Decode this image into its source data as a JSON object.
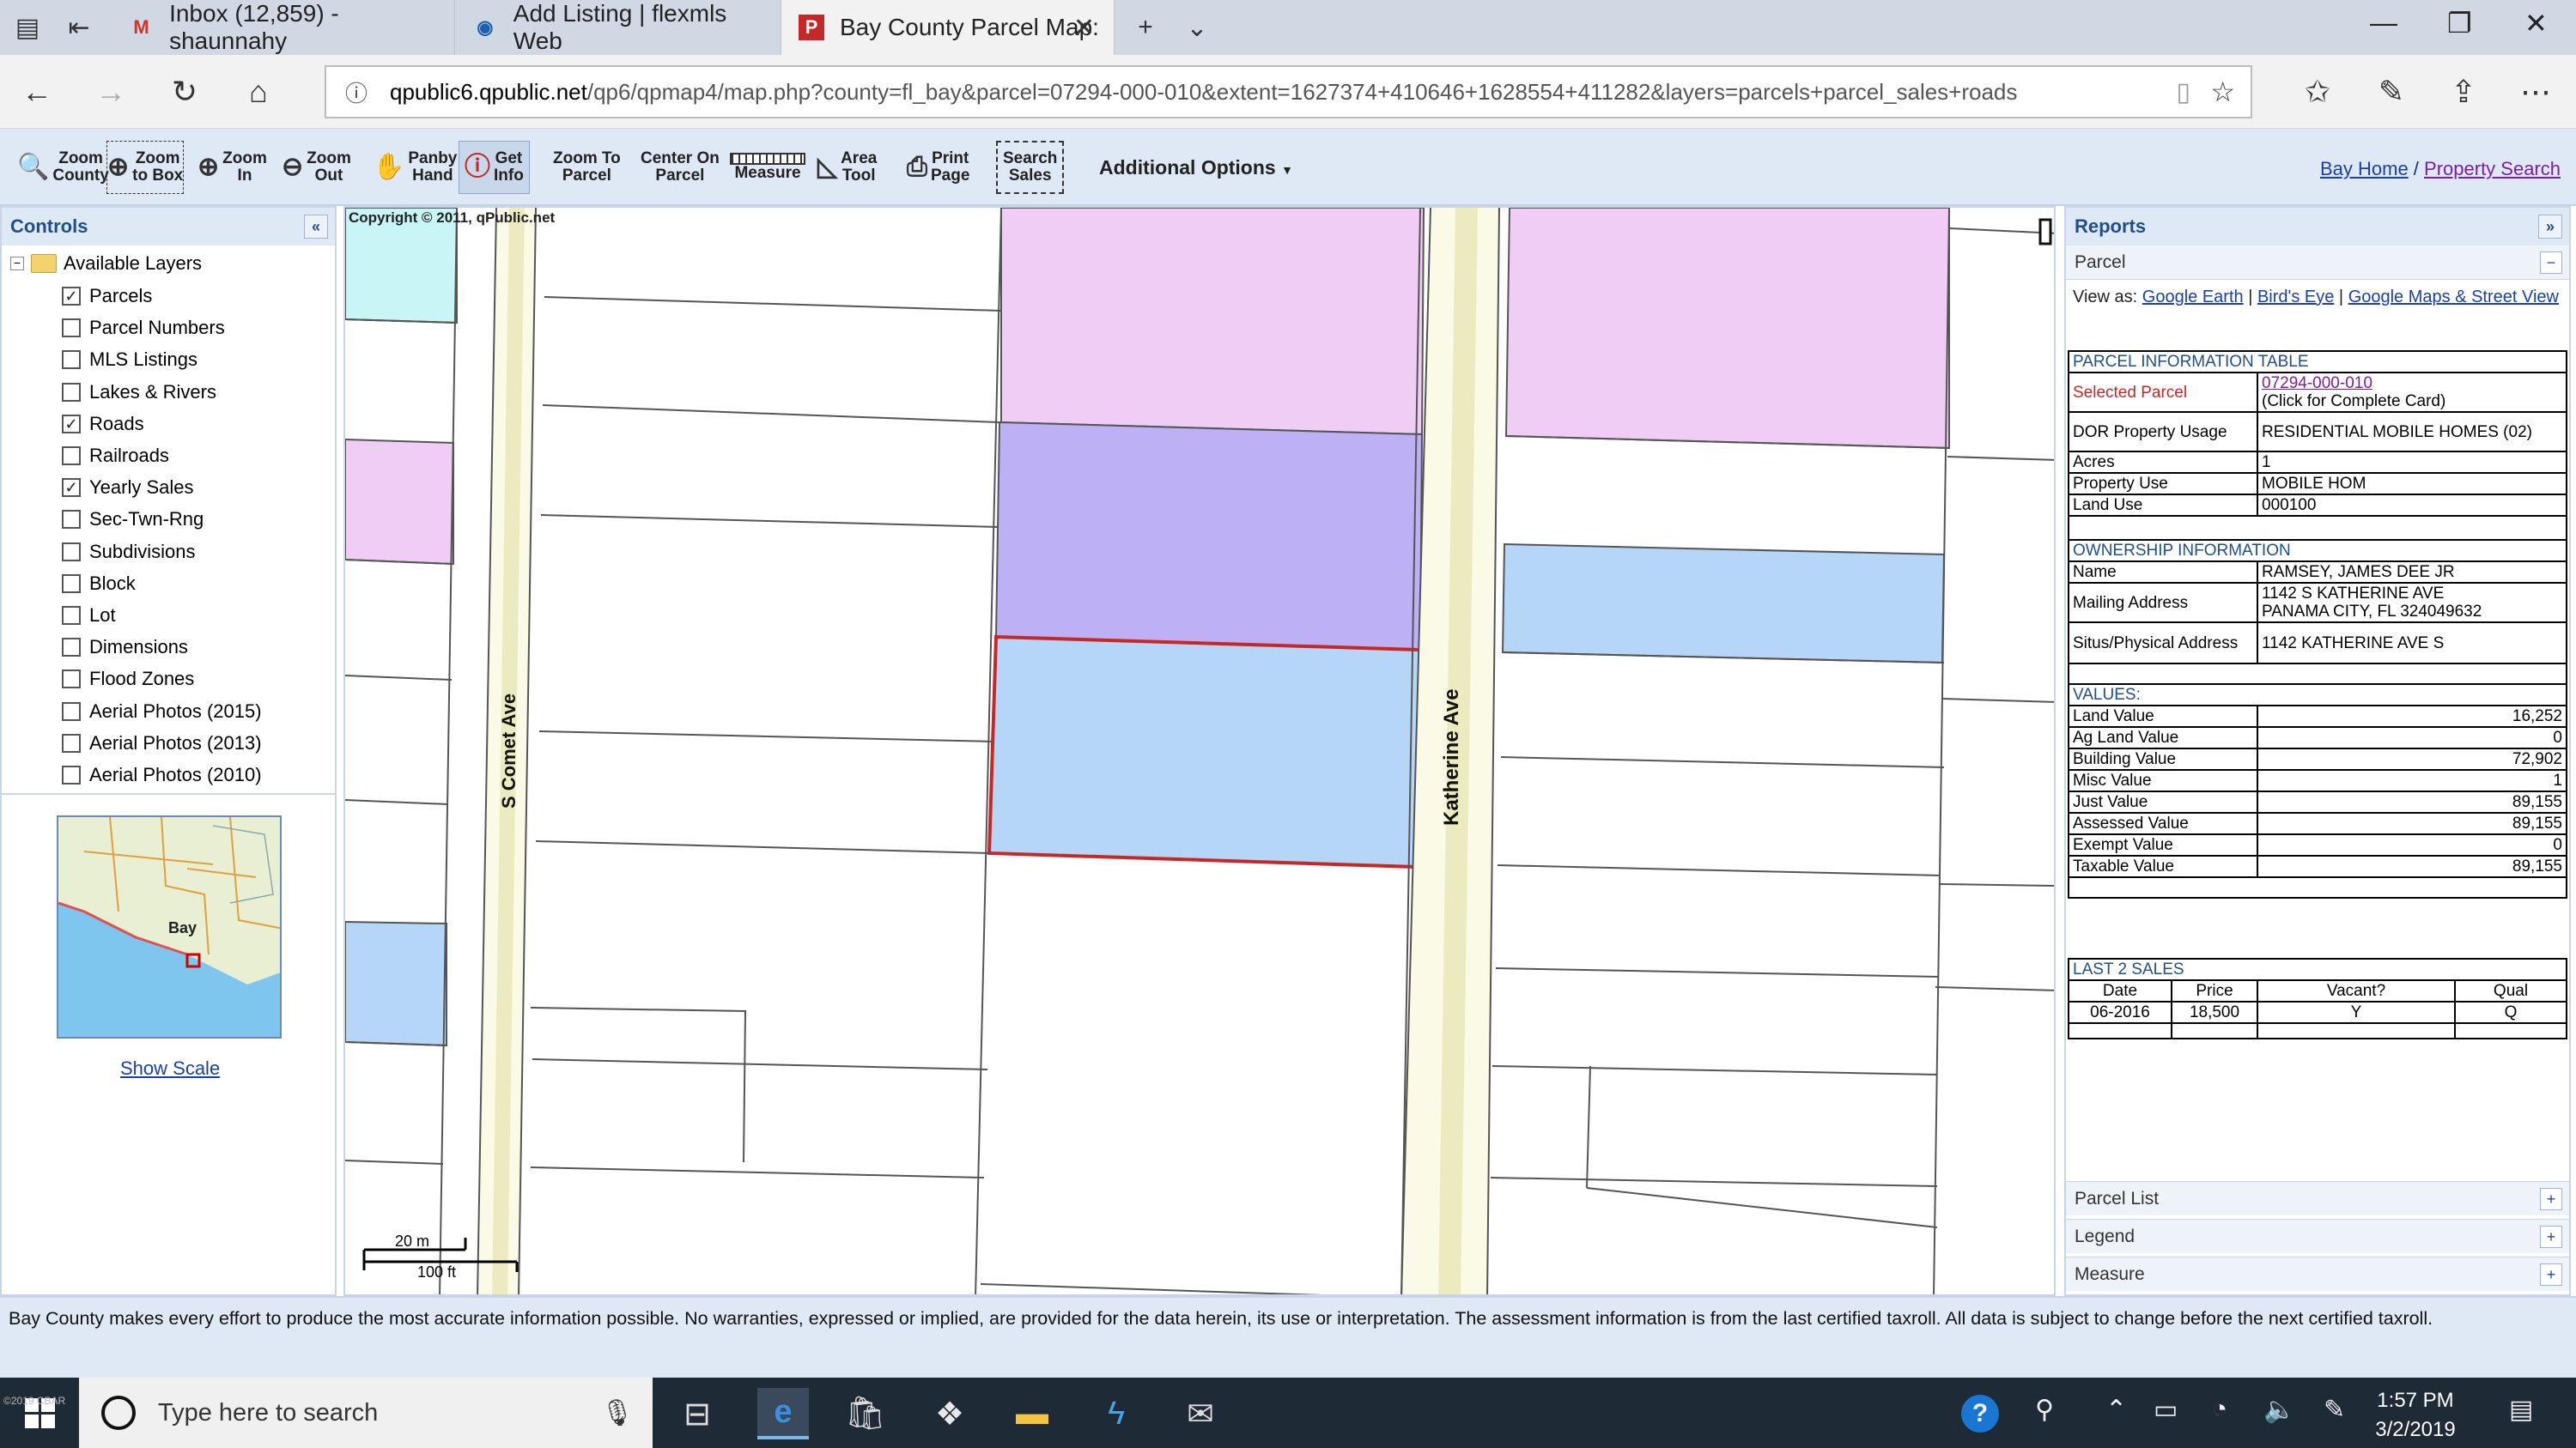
{
  "browser": {
    "tabs": [
      {
        "label": "Inbox (12,859) - shaunnahy",
        "favicon": "gmail-icon"
      },
      {
        "label": "Add Listing | flexmls Web",
        "favicon": "flexmls-icon"
      },
      {
        "label": "Bay County Parcel Map:",
        "favicon": "qpublic-icon",
        "active": true
      }
    ],
    "url_host": "qpublic6.qpublic.net",
    "url_path": "/qp6/qpmap4/map.php?county=fl_bay&parcel=07294-000-010&extent=1627374+410646+1628554+411282&layers=parcels+parcel_sales+roads"
  },
  "toolbar": {
    "tools": [
      {
        "line1": "Zoom",
        "line2": "County",
        "icon": "zoom-county-icon"
      },
      {
        "line1": "Zoom",
        "line2": "to Box",
        "icon": "zoom-box-icon"
      },
      {
        "line1": "Zoom",
        "line2": "In",
        "icon": "zoom-in-icon"
      },
      {
        "line1": "Zoom",
        "line2": "Out",
        "icon": "zoom-out-icon"
      },
      {
        "line1": "Panby",
        "line2": "Hand",
        "icon": "hand-icon"
      },
      {
        "line1": "Get",
        "line2": "Info",
        "icon": "info-icon",
        "active": true
      },
      {
        "line1": "Zoom To",
        "line2": "Parcel",
        "icon": ""
      },
      {
        "line1": "Center On",
        "line2": "Parcel",
        "icon": ""
      },
      {
        "line1": "",
        "line2": "Measure",
        "icon": "ruler-icon"
      },
      {
        "line1": "Area",
        "line2": "Tool",
        "icon": "area-icon"
      },
      {
        "line1": "Print",
        "line2": "Page",
        "icon": "printer-icon"
      },
      {
        "line1": "Search",
        "line2": "Sales",
        "icon": ""
      }
    ],
    "additional_options": "Additional Options",
    "link_home": "Bay Home",
    "link_sep": " / ",
    "link_search": "Property Search"
  },
  "controls": {
    "title": "Controls",
    "root_label": "Available Layers",
    "layers": [
      {
        "label": "Parcels",
        "checked": true
      },
      {
        "label": "Parcel Numbers",
        "checked": false
      },
      {
        "label": "MLS Listings",
        "checked": false
      },
      {
        "label": "Lakes & Rivers",
        "checked": false
      },
      {
        "label": "Roads",
        "checked": true
      },
      {
        "label": "Railroads",
        "checked": false
      },
      {
        "label": "Yearly Sales",
        "checked": true
      },
      {
        "label": "Sec-Twn-Rng",
        "checked": false
      },
      {
        "label": "Subdivisions",
        "checked": false
      },
      {
        "label": "Block",
        "checked": false
      },
      {
        "label": "Lot",
        "checked": false
      },
      {
        "label": "Dimensions",
        "checked": false
      },
      {
        "label": "Flood Zones",
        "checked": false
      },
      {
        "label": "Aerial Photos (2015)",
        "checked": false
      },
      {
        "label": "Aerial Photos (2013)",
        "checked": false
      },
      {
        "label": "Aerial Photos (2010)",
        "checked": false
      }
    ],
    "minimap_label": "Bay",
    "show_scale": "Show Scale"
  },
  "map": {
    "copyright": "Copyright © 2011, qPublic.net",
    "street_1": "S Comet Ave",
    "street_2": "Katherine Ave",
    "scale_m": "20 m",
    "scale_ft": "100 ft",
    "colors": {
      "sale_pink": "#f0cdf5",
      "sale_purple": "#bdb0f5",
      "sale_blue": "#b6d6f7",
      "selected_outline": "#c62828",
      "road": "#fafae6"
    }
  },
  "reports": {
    "title": "Reports",
    "parcel_section": "Parcel",
    "view_as_label": "View as:",
    "view_links": [
      "Google Earth",
      "Bird's Eye",
      "Google Maps & Street View"
    ],
    "parcel_info_title": "PARCEL INFORMATION TABLE",
    "selected_parcel_label": "Selected Parcel",
    "selected_parcel_id": "07294-000-010",
    "selected_parcel_note": "(Click for Complete Card)",
    "dor_label": "DOR Property Usage",
    "dor_value": "RESIDENTIAL MOBILE HOMES (02)",
    "acres_label": "Acres",
    "acres_value": "1",
    "property_use_label": "Property Use",
    "property_use_value": "MOBILE HOM",
    "land_use_label": "Land Use",
    "land_use_value": "000100",
    "ownership_title": "OWNERSHIP INFORMATION",
    "name_label": "Name",
    "name_value": "RAMSEY, JAMES DEE JR",
    "mailing_label": "Mailing Address",
    "mailing_line1": "1142 S KATHERINE AVE",
    "mailing_line2": "PANAMA CITY, FL 324049632",
    "situs_label": "Situs/Physical Address",
    "situs_value": "1142 KATHERINE AVE S",
    "values_title": "VALUES:",
    "values": [
      {
        "label": "Land Value",
        "value": "16,252"
      },
      {
        "label": "Ag Land Value",
        "value": "0"
      },
      {
        "label": "Building Value",
        "value": "72,902"
      },
      {
        "label": "Misc Value",
        "value": "1"
      },
      {
        "label": "Just Value",
        "value": "89,155"
      },
      {
        "label": "Assessed Value",
        "value": "89,155"
      },
      {
        "label": "Exempt Value",
        "value": "0"
      },
      {
        "label": "Taxable Value",
        "value": "89,155"
      }
    ],
    "sales_title": "LAST 2 SALES",
    "sales_headers": [
      "Date",
      "Price",
      "Vacant?",
      "Qual"
    ],
    "sales_rows": [
      [
        "06-2016",
        "18,500",
        "Y",
        "Q"
      ]
    ],
    "parcel_list": "Parcel List",
    "legend": "Legend",
    "measure": "Measure"
  },
  "footer": {
    "disclaimer": "Bay County makes every effort to produce the most accurate information possible. No warranties, expressed or implied, are provided for the data herein, its use or interpretation. The assessment information is from the last certified taxroll. All data is subject to change before the next certified taxroll."
  },
  "taskbar": {
    "search_placeholder": "Type here to search",
    "time": "1:57 PM",
    "date": "3/2/2019",
    "watermark": "©2019 CBAR"
  }
}
